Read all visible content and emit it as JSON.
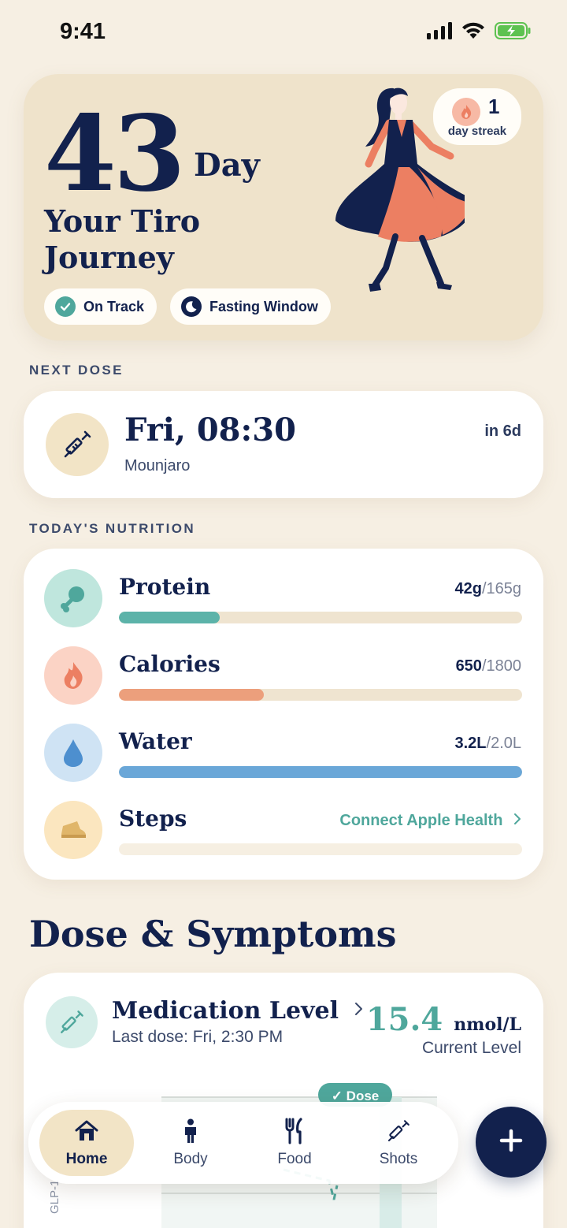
{
  "status_bar": {
    "time": "9:41"
  },
  "hero": {
    "days": "43",
    "day_unit": "Day",
    "title": "Your Tiro Journey",
    "streak_count": "1",
    "streak_label": "day streak",
    "chips": [
      {
        "label": "On Track",
        "icon": "check-circle-icon"
      },
      {
        "label": "Fasting Window",
        "icon": "moon-icon"
      }
    ]
  },
  "next_dose": {
    "section_label": "NEXT DOSE",
    "time": "Fri, 08:30",
    "medication": "Mounjaro",
    "countdown": "in 6d",
    "icon": "syringe-icon"
  },
  "nutrition": {
    "section_label": "TODAY'S NUTRITION",
    "items": [
      {
        "name": "Protein",
        "value": "42g",
        "goal": "/165g",
        "fraction": 0.25,
        "color": "#5cb3a9",
        "icon_bg": "#bfe6dd",
        "icon": "drumstick-icon"
      },
      {
        "name": "Calories",
        "value": "650",
        "goal": "/1800",
        "fraction": 0.36,
        "color": "#ec9f7c",
        "icon_bg": "#fbd3c5",
        "icon": "flame-icon"
      },
      {
        "name": "Water",
        "value": "3.2L",
        "goal": "/2.0L",
        "fraction": 1.0,
        "color": "#6aa7d8",
        "icon_bg": "#cfe3f4",
        "icon": "water-drop-icon"
      },
      {
        "name": "Steps",
        "link": "Connect Apple Health",
        "fraction": 0,
        "color": "#f3ead9",
        "icon_bg": "#fbe6bf",
        "icon": "shoe-icon"
      }
    ]
  },
  "dose_symptoms": {
    "title": "Dose & Symptoms",
    "medication_level": {
      "title": "Medication Level",
      "subtitle": "Last dose: Fri, 2:30 PM",
      "value": "15.4",
      "unit": "nmol/L",
      "value_label": "Current Level",
      "chart_axis_label": "GLP-1",
      "dose_marker": "✓ Dose"
    }
  },
  "tab_bar": {
    "tabs": [
      {
        "label": "Home",
        "icon": "house-icon",
        "active": true
      },
      {
        "label": "Body",
        "icon": "person-icon",
        "active": false
      },
      {
        "label": "Food",
        "icon": "fork-knife-icon",
        "active": false
      },
      {
        "label": "Shots",
        "icon": "syringe-icon",
        "active": false
      }
    ],
    "fab_icon": "plus-icon"
  },
  "colors": {
    "background": "#f6efe3",
    "navy": "#12214d",
    "teal": "#4fa79c",
    "hero_bg": "#efe3cb"
  }
}
